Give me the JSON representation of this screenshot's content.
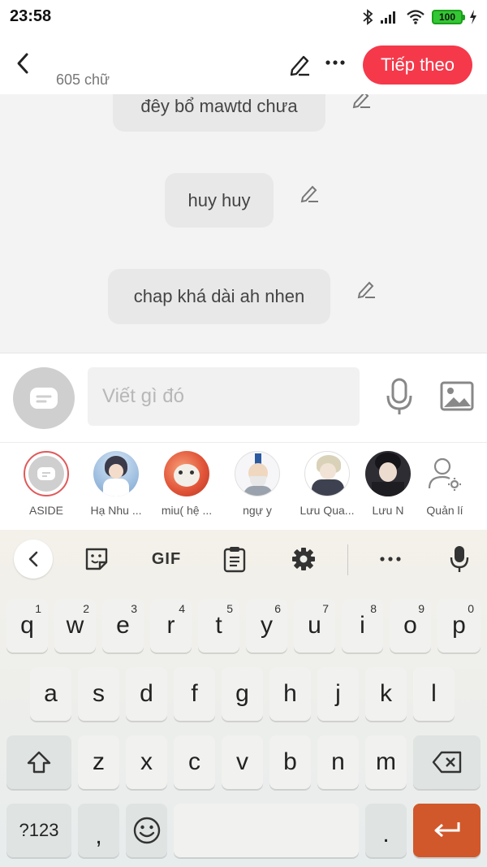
{
  "status_bar": {
    "time": "23:58",
    "battery": "100"
  },
  "top_bar": {
    "word_count": "605 chữ",
    "next_label": "Tiếp theo"
  },
  "messages": [
    {
      "text": "đêy bổ mawtd chưa"
    },
    {
      "text": "huy huy"
    },
    {
      "text": "chap khá dài ah nhen"
    }
  ],
  "composer": {
    "placeholder": "Viết gì đó"
  },
  "characters": [
    {
      "name": "ASIDE"
    },
    {
      "name": "Hạ Nhu ..."
    },
    {
      "name": "miu( hệ ..."
    },
    {
      "name": "ngự y"
    },
    {
      "name": "Lưu Qua..."
    },
    {
      "name": "Lưu N"
    },
    {
      "name": "Quản lí"
    }
  ],
  "keyboard": {
    "gif_label": "GIF",
    "row1": [
      {
        "key": "q",
        "hint": "1"
      },
      {
        "key": "w",
        "hint": "2"
      },
      {
        "key": "e",
        "hint": "3"
      },
      {
        "key": "r",
        "hint": "4"
      },
      {
        "key": "t",
        "hint": "5"
      },
      {
        "key": "y",
        "hint": "6"
      },
      {
        "key": "u",
        "hint": "7"
      },
      {
        "key": "i",
        "hint": "8"
      },
      {
        "key": "o",
        "hint": "9"
      },
      {
        "key": "p",
        "hint": "0"
      }
    ],
    "row2": [
      "a",
      "s",
      "d",
      "f",
      "g",
      "h",
      "j",
      "k",
      "l"
    ],
    "row3": [
      "z",
      "x",
      "c",
      "v",
      "b",
      "n",
      "m"
    ],
    "symbols_label": "?123",
    "comma_label": ",",
    "period_label": "."
  },
  "colors": {
    "accent": "#f5394b",
    "enter_key": "#d1582a"
  }
}
